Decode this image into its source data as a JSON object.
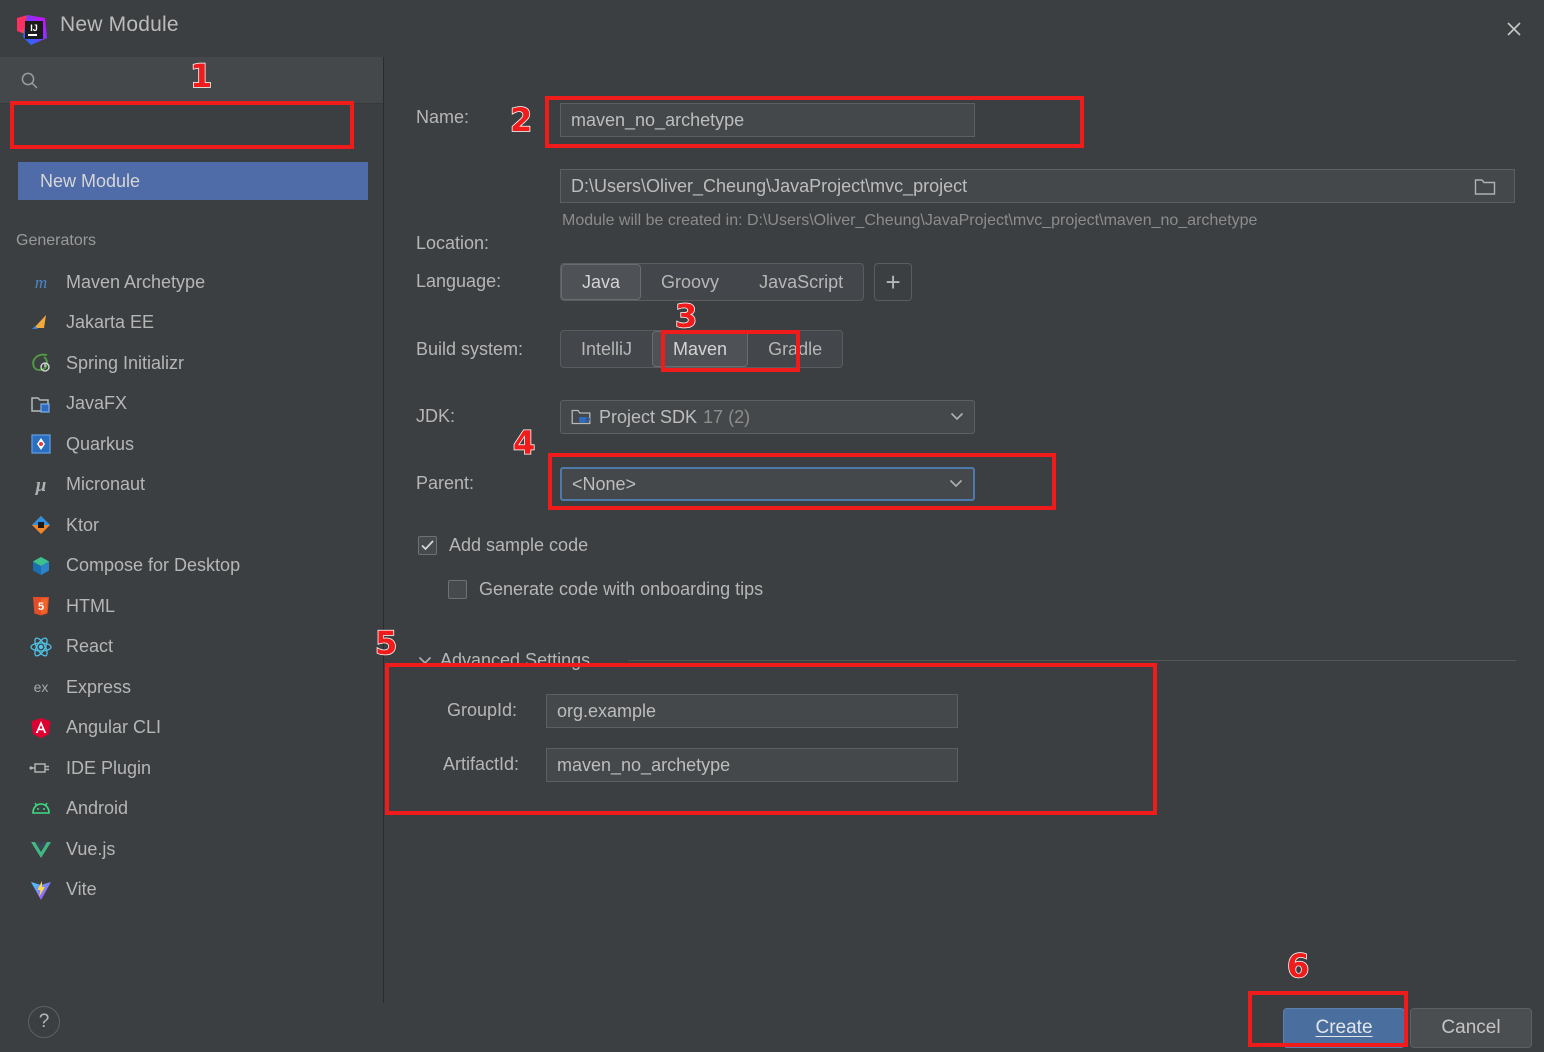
{
  "window": {
    "title": "New Module",
    "app_icon": "intellij-idea-logo",
    "close_icon": "close-icon"
  },
  "sidebar": {
    "search": {
      "placeholder": "",
      "value": "",
      "icon": "search-icon"
    },
    "selected_item": "New Module",
    "section_label": "Generators",
    "items": [
      {
        "label": "Maven Archetype",
        "icon": "maven-icon"
      },
      {
        "label": "Jakarta EE",
        "icon": "jakarta-ee-icon"
      },
      {
        "label": "Spring Initializr",
        "icon": "spring-icon"
      },
      {
        "label": "JavaFX",
        "icon": "javafx-icon"
      },
      {
        "label": "Quarkus",
        "icon": "quarkus-icon"
      },
      {
        "label": "Micronaut",
        "icon": "micronaut-icon"
      },
      {
        "label": "Ktor",
        "icon": "ktor-icon"
      },
      {
        "label": "Compose for Desktop",
        "icon": "compose-icon"
      },
      {
        "label": "HTML",
        "icon": "html5-icon"
      },
      {
        "label": "React",
        "icon": "react-icon"
      },
      {
        "label": "Express",
        "icon": "express-icon"
      },
      {
        "label": "Angular CLI",
        "icon": "angular-icon"
      },
      {
        "label": "IDE Plugin",
        "icon": "plugin-icon"
      },
      {
        "label": "Android",
        "icon": "android-icon"
      },
      {
        "label": "Vue.js",
        "icon": "vue-icon"
      },
      {
        "label": "Vite",
        "icon": "vite-icon"
      }
    ]
  },
  "form": {
    "name_label": "Name:",
    "name_value": "maven_no_archetype",
    "location_label": "Location:",
    "location_value": "D:\\Users\\Oliver_Cheung\\JavaProject\\mvc_project",
    "location_browse_icon": "folder-icon",
    "location_hint": "Module will be created in: D:\\Users\\Oliver_Cheung\\JavaProject\\mvc_project\\maven_no_archetype",
    "language_label": "Language:",
    "language_options": [
      "Java",
      "Groovy",
      "JavaScript"
    ],
    "language_selected": "Java",
    "language_add_icon": "plus-icon",
    "build_system_label": "Build system:",
    "build_system_options": [
      "IntelliJ",
      "Maven",
      "Gradle"
    ],
    "build_system_selected": "Maven",
    "jdk_label": "JDK:",
    "jdk_value": "Project SDK",
    "jdk_value_suffix": "17 (2)",
    "jdk_icon": "jdk-folder-icon",
    "parent_label": "Parent:",
    "parent_value": "<None>",
    "add_sample_code_label": "Add sample code",
    "add_sample_code_checked": true,
    "onboarding_tips_label": "Generate code with onboarding tips",
    "onboarding_tips_checked": false,
    "advanced_settings_label": "Advanced Settings",
    "advanced_settings_expanded": true,
    "group_id_label": "GroupId:",
    "group_id_value": "org.example",
    "artifact_id_label": "ArtifactId:",
    "artifact_id_value": "maven_no_archetype"
  },
  "footer": {
    "help_label": "?",
    "create_label": "Create",
    "cancel_label": "Cancel"
  },
  "annotations": {
    "step1": "1",
    "step2": "2",
    "step3": "3",
    "step4": "4",
    "step5": "5",
    "step6": "6"
  },
  "colors": {
    "dialog_bg": "#3c3f41",
    "field_bg": "#45484a",
    "selection_blue": "#4f6ba8",
    "primary_button": "#4a6f9e",
    "annotation_red": "#f01c1c",
    "focus_border": "#4d7aaa"
  }
}
